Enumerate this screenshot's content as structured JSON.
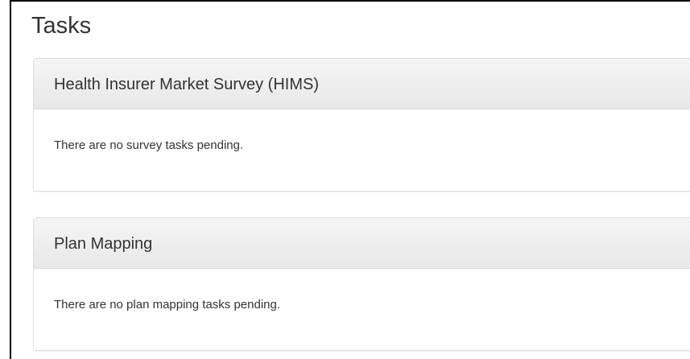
{
  "page": {
    "title": "Tasks"
  },
  "panels": [
    {
      "heading": "Health Insurer Market Survey (HIMS)",
      "body": "There are no survey tasks pending."
    },
    {
      "heading": "Plan Mapping",
      "body": "There are no plan mapping tasks pending."
    }
  ],
  "colors": {
    "text": "#333333",
    "panel_border": "#dddddd",
    "heading_bg_top": "#f5f5f5",
    "heading_bg_bottom": "#e8e8e8",
    "frame_border": "#000000"
  }
}
